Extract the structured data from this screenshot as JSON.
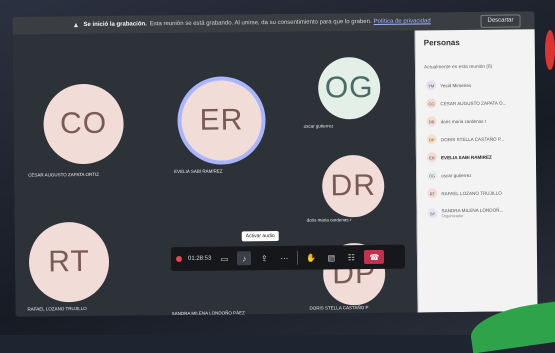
{
  "banner": {
    "prefix": "Se inició la grabación.",
    "text": "Esta reunión se está grabando. Al unirse, da su consentimiento para que lo graben.",
    "link": "Política de privacidad",
    "dismiss_label": "Descartar"
  },
  "tiles": [
    {
      "initials": "CO",
      "name": "CÉSAR AUGUSTO ZAPATA ORTIZ"
    },
    {
      "initials": "ER",
      "name": "EVELIA SABI RAMIREZ"
    },
    {
      "initials": "OG",
      "name": "oscar gutierrez"
    },
    {
      "initials": "DR",
      "name": "doris maria cardenas r"
    },
    {
      "initials": "RT",
      "name": "RAFAEL LOZANO TRUJILLO"
    },
    {
      "initials": "DP",
      "name": "DORIS STELLA CASTAÑO P"
    },
    {
      "initials": "",
      "name": "SANDRA MILENA LONDOÑO PÁEZ"
    }
  ],
  "controls": {
    "timer": "01:28:53",
    "tooltip": "Activar audio"
  },
  "panel": {
    "title": "Personas",
    "section": "Actualmente en esta reunión (8)",
    "people": [
      {
        "initials": "YM",
        "name": "Yesid Mimeries",
        "sub": ""
      },
      {
        "initials": "CO",
        "name": "CÉSAR AUGUSTO ZAPATA O...",
        "sub": ""
      },
      {
        "initials": "DR",
        "name": "doris maria cardenas r",
        "sub": ""
      },
      {
        "initials": "DP",
        "name": "DORIS STELLA CASTAÑO P...",
        "sub": ""
      },
      {
        "initials": "ER",
        "name": "EVELIA SABI RAMIREZ",
        "sub": ""
      },
      {
        "initials": "OG",
        "name": "oscar gutierrez",
        "sub": ""
      },
      {
        "initials": "RT",
        "name": "RAFAEL LOZANO TRUJILLO",
        "sub": ""
      },
      {
        "initials": "SP",
        "name": "SANDRA MILENA LONDOÑ...",
        "sub": "Organizador"
      }
    ]
  },
  "colors": {
    "speaking_ring": "#aab5ff",
    "hangup": "#c4314b",
    "recording": "#e04a4a"
  }
}
